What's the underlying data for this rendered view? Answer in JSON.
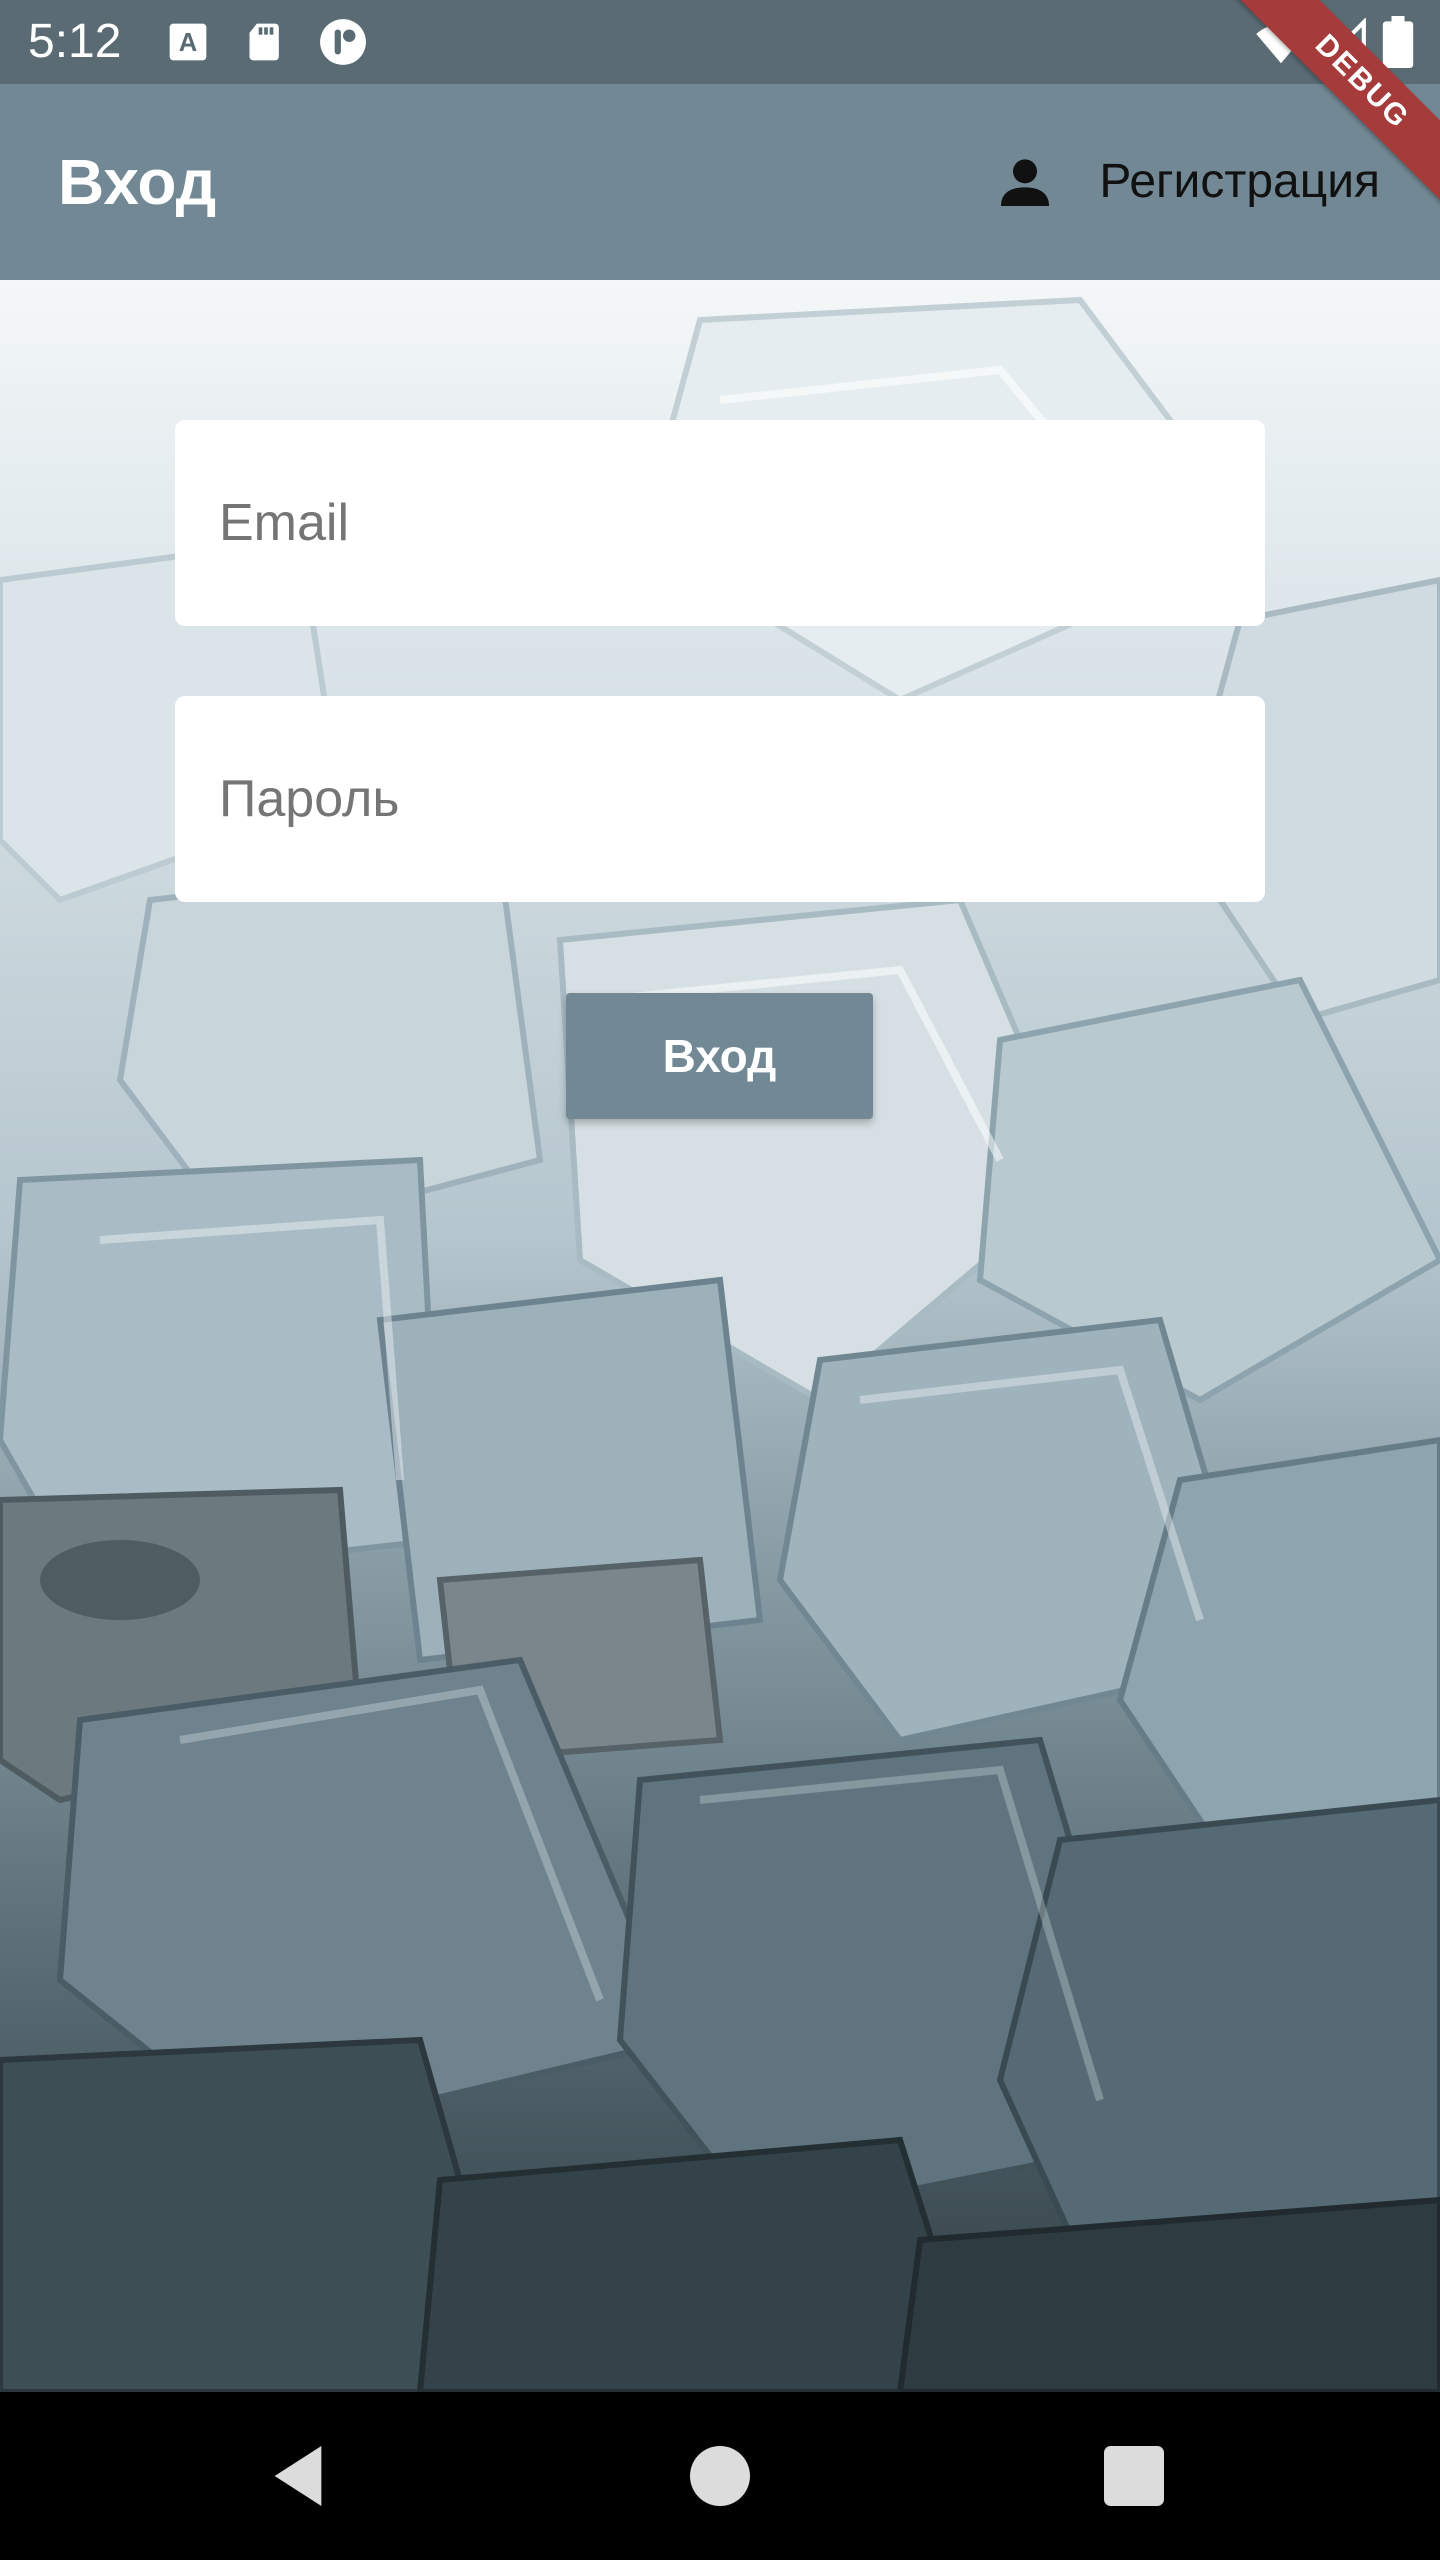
{
  "status_bar": {
    "time": "5:12",
    "icons": [
      "text-a-icon",
      "sd-card-icon",
      "app-notification-icon",
      "wifi-icon",
      "signal-icon",
      "battery-icon"
    ]
  },
  "app_bar": {
    "title": "Вход",
    "register_label": "Регистрация",
    "register_icon": "person-icon"
  },
  "debug_banner": "DEBUG",
  "form": {
    "email_placeholder": "Email",
    "email_value": "",
    "password_placeholder": "Пароль",
    "password_value": "",
    "login_button": "Вход"
  },
  "nav_bar": {
    "buttons": [
      "back-icon",
      "home-icon",
      "recents-icon"
    ]
  },
  "colors": {
    "status_bar": "#5a6b74",
    "app_bar": "#728894",
    "button": "#728894",
    "debug": "#a63b3b"
  }
}
